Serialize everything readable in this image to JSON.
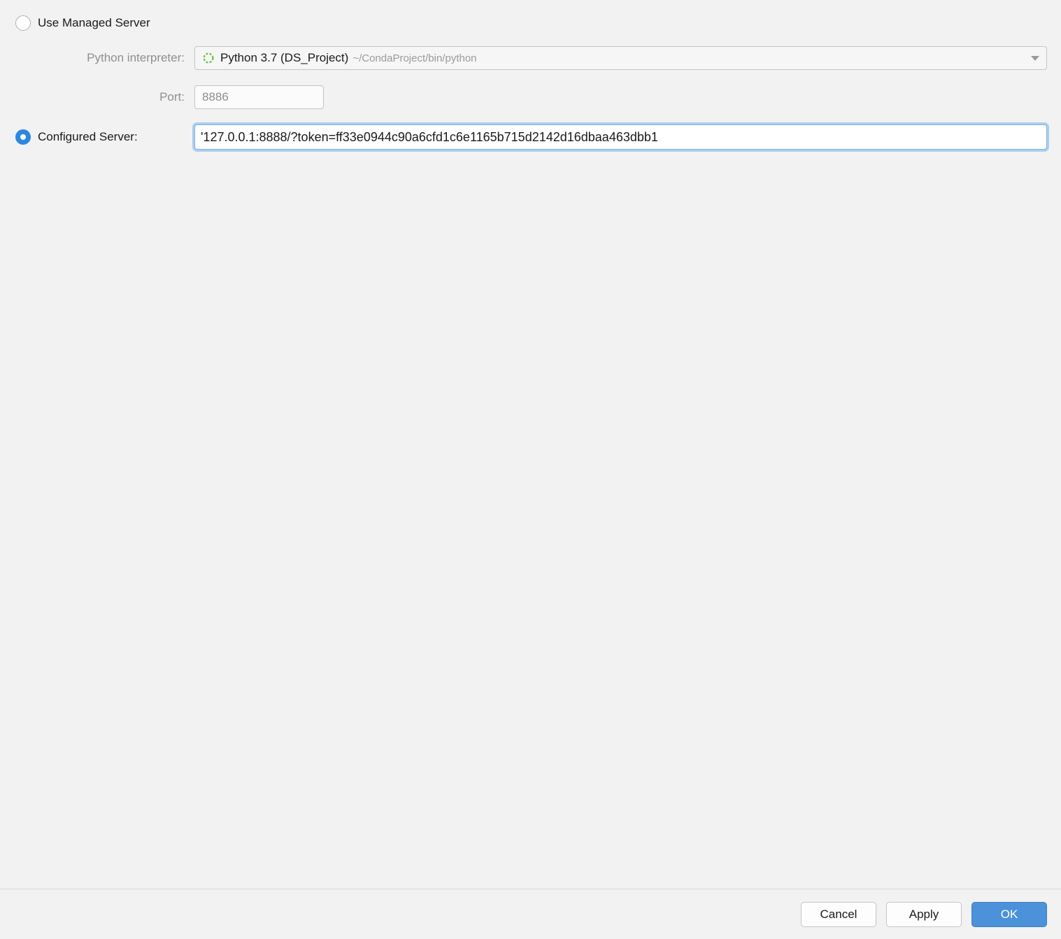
{
  "options": {
    "managed": {
      "label": "Use Managed Server",
      "interpreter_label": "Python interpreter:",
      "interpreter_name": "Python 3.7 (DS_Project)",
      "interpreter_path": "~/CondaProject/bin/python",
      "port_label": "Port:",
      "port_value": "8886"
    },
    "configured": {
      "label": "Configured Server:",
      "url": "'127.0.0.1:8888/?token=ff33e0944c90a6cfd1c6e1165b715d2142d16dbaa463dbb1"
    }
  },
  "buttons": {
    "cancel": "Cancel",
    "apply": "Apply",
    "ok": "OK"
  }
}
